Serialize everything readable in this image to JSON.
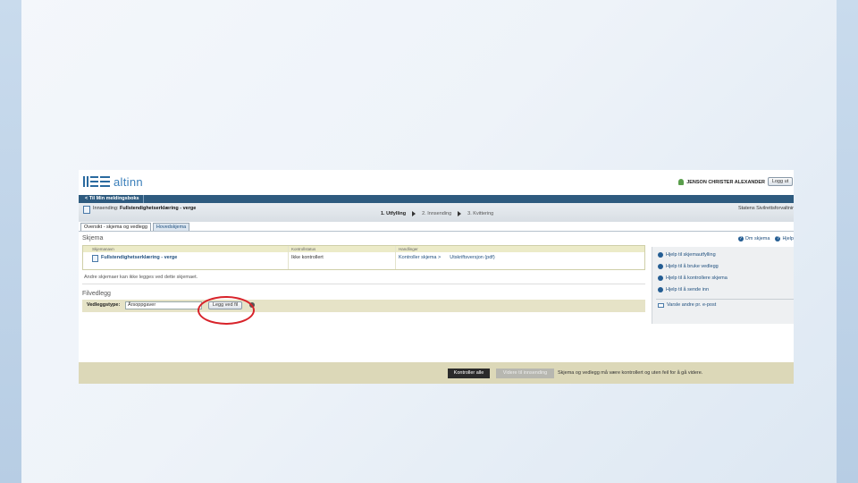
{
  "header": {
    "logo_text": "altinn",
    "user_name": "JENSON CHRISTER ALEXANDER",
    "logout_label": "Logg ut"
  },
  "nav": {
    "back_label": "< Til Min meldingsboks"
  },
  "submission": {
    "label_prefix": "Innsending:",
    "form_title": "Fullstendighetserklæring - verge",
    "agency": "Statens Sivilrettsforvaltnir",
    "steps": [
      "1. Utfylling",
      "2. Innsending",
      "3. Kvittering"
    ]
  },
  "tabs": [
    "Oversikt - skjema og vedlegg",
    "Hovedskjema"
  ],
  "skjema": {
    "heading": "Skjema",
    "help_links": [
      "Om skjema",
      "Hjelp"
    ],
    "columns": [
      "Skjemanavn",
      "Kontrollstatus",
      "Handlinger"
    ],
    "row": {
      "name": "Fullstendighetserklæring - verge",
      "status": "Ikke kontrollert",
      "action_control": "Kontroller skjema >",
      "action_print": "Utskriftsversjon (pdf)"
    },
    "note": "Andre skjemaer kan ikke legges ved dette skjemaet."
  },
  "filvedlegg": {
    "heading": "Filvedlegg",
    "type_label": "Vedleggstype:",
    "type_value": "Årsoppgaver",
    "add_button": "Legg ved fil"
  },
  "sidepanel": {
    "items": [
      "Hjelp til skjemautfylling",
      "Hjelp til å bruke vedlegg",
      "Hjelp til å kontrollere skjema",
      "Hjelp til å sende inn"
    ],
    "notify": "Varsle andre pr. e-post"
  },
  "footer": {
    "check_all": "Kontroller alle",
    "next": "Videre til innsending",
    "message": "Skjema og vedlegg må være kontrollert og uten feil for å gå videre."
  },
  "colors": {
    "nav_blue": "#2e5b7f",
    "link_blue": "#1f4f7e",
    "highlight_red": "#d8232a",
    "footer_bg": "#dcd8b8"
  }
}
